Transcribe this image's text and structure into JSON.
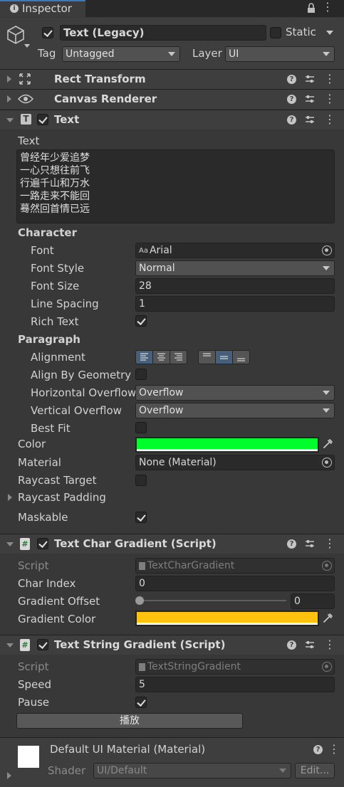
{
  "tab": {
    "title": "Inspector"
  },
  "object": {
    "name": "Text (Legacy)",
    "static_label": "Static",
    "tag_label": "Tag",
    "tag_value": "Untagged",
    "layer_label": "Layer",
    "layer_value": "UI"
  },
  "components": {
    "rect_transform": "Rect Transform",
    "canvas_renderer": "Canvas Renderer",
    "text": "Text"
  },
  "text_component": {
    "text_label": "Text",
    "text_lines": [
      "曾经年少爱追梦",
      "一心只想往前飞",
      "行遍千山和万水",
      "一路走来不能回",
      "蓦然回首情已远"
    ],
    "character_header": "Character",
    "font_label": "Font",
    "font_value": "Arial",
    "font_prefix": "Aa",
    "font_style_label": "Font Style",
    "font_style_value": "Normal",
    "font_size_label": "Font Size",
    "font_size_value": "28",
    "line_spacing_label": "Line Spacing",
    "line_spacing_value": "1",
    "rich_text_label": "Rich Text",
    "paragraph_header": "Paragraph",
    "alignment_label": "Alignment",
    "align_by_geometry_label": "Align By Geometry",
    "horizontal_overflow_label": "Horizontal Overflow",
    "horizontal_overflow_value": "Overflow",
    "vertical_overflow_label": "Vertical Overflow",
    "vertical_overflow_value": "Overflow",
    "best_fit_label": "Best Fit",
    "color_label": "Color",
    "color_value": "#00ff2a",
    "material_label": "Material",
    "material_value": "None (Material)",
    "raycast_target_label": "Raycast Target",
    "raycast_padding_label": "Raycast Padding",
    "maskable_label": "Maskable"
  },
  "char_gradient": {
    "title": "Text Char Gradient (Script)",
    "script_label": "Script",
    "script_value": "TextCharGradient",
    "char_index_label": "Char Index",
    "char_index_value": "0",
    "gradient_offset_label": "Gradient Offset",
    "gradient_offset_value": "0",
    "gradient_color_label": "Gradient Color",
    "gradient_color_value": "#ffc20e"
  },
  "string_gradient": {
    "title": "Text String Gradient (Script)",
    "script_label": "Script",
    "script_value": "TextStringGradient",
    "speed_label": "Speed",
    "speed_value": "5",
    "pause_label": "Pause",
    "play_button": "播放"
  },
  "material_footer": {
    "name": "Default UI Material (Material)",
    "shader_label": "Shader",
    "shader_value": "UI/Default",
    "edit_button": "Edit..."
  }
}
